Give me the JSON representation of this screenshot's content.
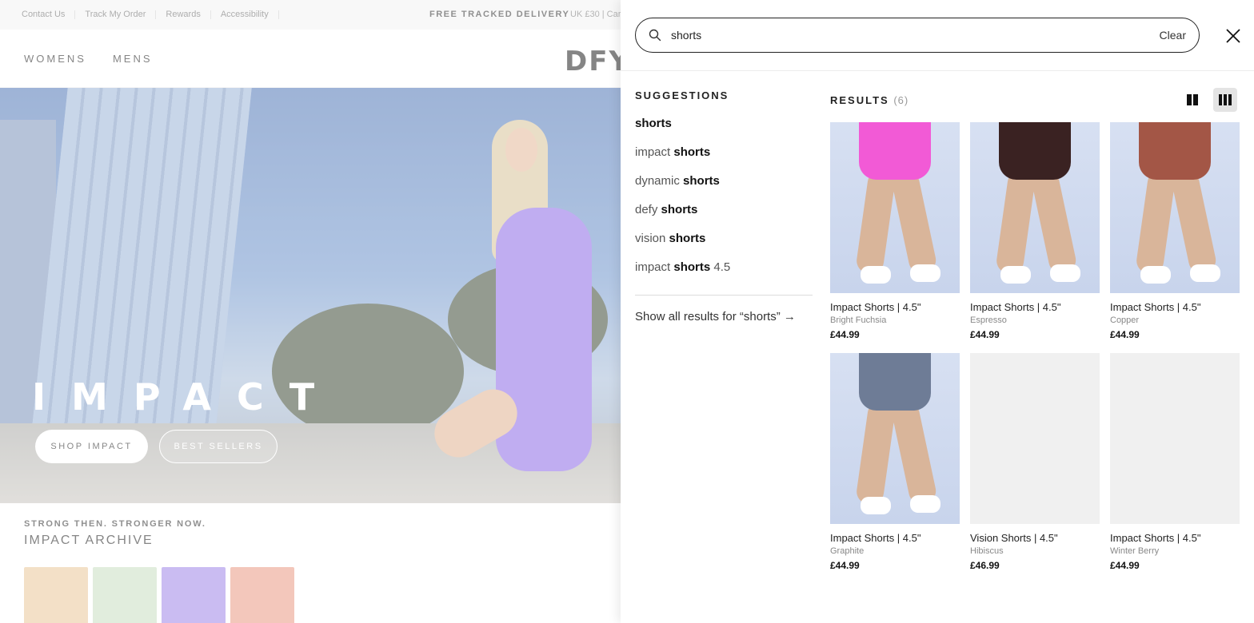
{
  "topbar": {
    "links": [
      "Contact Us",
      "Track My Order",
      "Rewards",
      "Accessibility"
    ],
    "delivery": "FREE TRACKED DELIVERY",
    "delivery_sub": "UK £30 | Car"
  },
  "nav": {
    "items": [
      "WOMENS",
      "MENS"
    ],
    "logo": "DFY"
  },
  "hero": {
    "title": "IMPACT",
    "shop_label": "SHOP IMPACT",
    "best_label": "BEST SELLERS"
  },
  "archive": {
    "eyebrow": "STRONG THEN. STRONGER NOW.",
    "title": "IMPACT ARCHIVE"
  },
  "search": {
    "value": "shorts",
    "clear_label": "Clear"
  },
  "suggestions": {
    "heading": "SUGGESTIONS",
    "items": [
      {
        "pre": "",
        "match": "shorts",
        "post": ""
      },
      {
        "pre": "impact ",
        "match": "shorts",
        "post": ""
      },
      {
        "pre": "dynamic ",
        "match": "shorts",
        "post": ""
      },
      {
        "pre": "defy ",
        "match": "shorts",
        "post": ""
      },
      {
        "pre": "vision ",
        "match": "shorts",
        "post": ""
      },
      {
        "pre": "impact ",
        "match": "shorts",
        "post": " 4.5"
      }
    ],
    "show_all": "Show all results for “shorts” →"
  },
  "results": {
    "heading": "RESULTS",
    "count": "(6)",
    "products": [
      {
        "name": "Impact Shorts | 4.5\"",
        "color": "Bright Fuchsia",
        "price": "£44.99",
        "swatch": "#f25ad6",
        "has_image": true
      },
      {
        "name": "Impact Shorts | 4.5\"",
        "color": "Espresso",
        "price": "£44.99",
        "swatch": "#3a2222",
        "has_image": true
      },
      {
        "name": "Impact Shorts | 4.5\"",
        "color": "Copper",
        "price": "£44.99",
        "swatch": "#a35646",
        "has_image": true
      },
      {
        "name": "Impact Shorts | 4.5\"",
        "color": "Graphite",
        "price": "£44.99",
        "swatch": "#6e7c96",
        "has_image": true
      },
      {
        "name": "Vision Shorts | 4.5\"",
        "color": "Hibiscus",
        "price": "£46.99",
        "swatch": "#f0f0f0",
        "has_image": false
      },
      {
        "name": "Impact Shorts | 4.5\"",
        "color": "Winter Berry",
        "price": "£44.99",
        "swatch": "#f0f0f0",
        "has_image": false
      }
    ]
  },
  "colors": {
    "accent": "#111111",
    "panel_bg": "#ffffff",
    "page_bg": "#f2f2f2"
  }
}
